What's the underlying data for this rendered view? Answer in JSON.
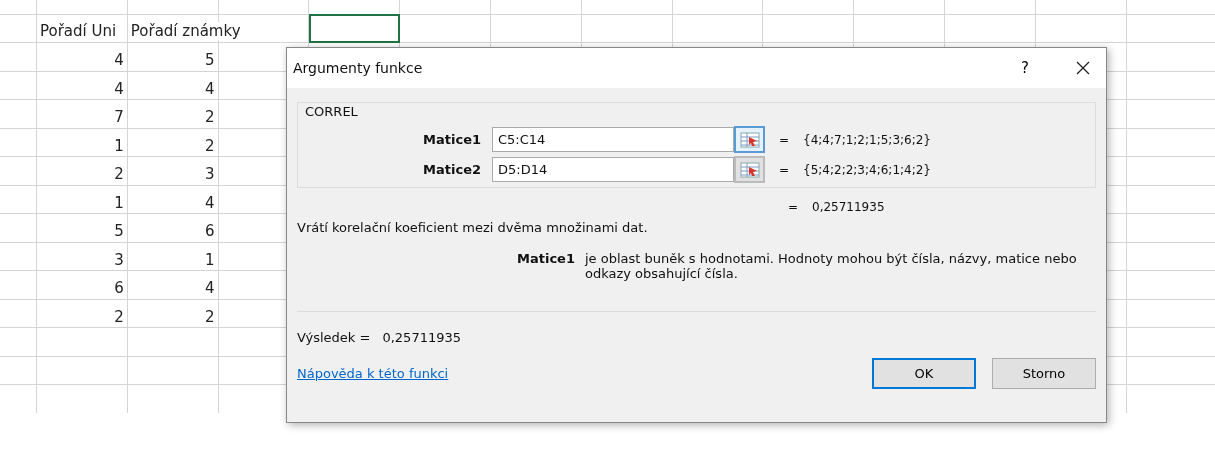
{
  "sheet": {
    "headers": [
      "Pořadí Uni",
      "Pořadí známky"
    ],
    "rows": [
      [
        "4",
        "5"
      ],
      [
        "4",
        "4"
      ],
      [
        "7",
        "2"
      ],
      [
        "1",
        "2"
      ],
      [
        "2",
        "3"
      ],
      [
        "1",
        "4"
      ],
      [
        "5",
        "6"
      ],
      [
        "3",
        "1"
      ],
      [
        "6",
        "4"
      ],
      [
        "2",
        "2"
      ]
    ]
  },
  "dialog": {
    "title": "Argumenty funkce",
    "help": "?",
    "function_name": "CORREL",
    "arguments": [
      {
        "label": "Matice1",
        "value": "C5:C14",
        "result": "{4;4;7;1;2;1;5;3;6;2}",
        "focused": true
      },
      {
        "label": "Matice2",
        "value": "D5:D14",
        "result": "{5;4;2;2;3;4;6;1;4;2}",
        "focused": false
      }
    ],
    "formula_result": "0,25711935",
    "equals": "=",
    "description": "Vrátí korelační koeficient mezi dvěma množinami dat.",
    "argument_help": {
      "name": "Matice1",
      "text": "je oblast buněk s hodnotami. Hodnoty mohou být čísla, názvy, matice nebo odkazy obsahující čísla."
    },
    "result_label": "Výsledek =",
    "result_value": "0,25711935",
    "help_link": "Nápověda k této funkci",
    "buttons": [
      {
        "label": "OK",
        "default": true
      },
      {
        "label": "Storno",
        "default": false
      }
    ]
  }
}
